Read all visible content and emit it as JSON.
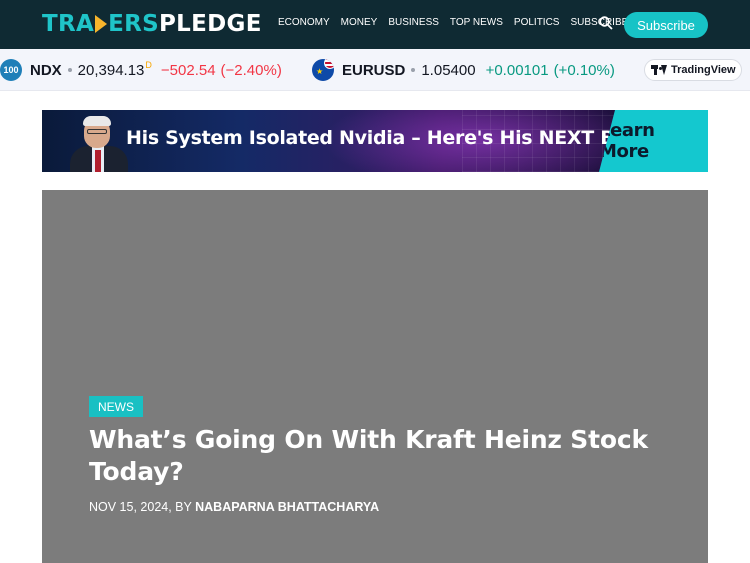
{
  "header": {
    "logo_part1": "TRA",
    "logo_part2": "ERS",
    "logo_part3": "PLEDGE",
    "nav": [
      "ECONOMY",
      "MONEY",
      "BUSINESS",
      "TOP NEWS",
      "POLITICS",
      "SUBSCRIBE"
    ],
    "subscribe_label": "Subscribe",
    "colors": {
      "bg": "#0f2a33",
      "accent": "#17c3c6",
      "logo_arrow": "#f7b52c"
    }
  },
  "ticker": {
    "items": [
      {
        "badge": "100",
        "symbol": "NDX",
        "price": "20,394.13",
        "delayed_mark": "D",
        "change": "−502.54",
        "change_pct": "(−2.40%)",
        "direction": "down"
      },
      {
        "symbol": "EURUSD",
        "price": "1.05400",
        "change": "+0.00101",
        "change_pct": "(+0.10%)",
        "direction": "up"
      }
    ],
    "brand": "TradingView",
    "colors": {
      "down": "#f23645",
      "up": "#089981"
    }
  },
  "ad": {
    "headline": "His System Isolated Nvidia – Here's His NEXT Buy",
    "cta": "Learn More"
  },
  "article": {
    "category": "NEWS",
    "title": "What’s Going On With Kraft Heinz Stock Today?",
    "date": "NOV 15, 2024, BY",
    "author": "NABAPARNA BHATTACHARYA"
  }
}
